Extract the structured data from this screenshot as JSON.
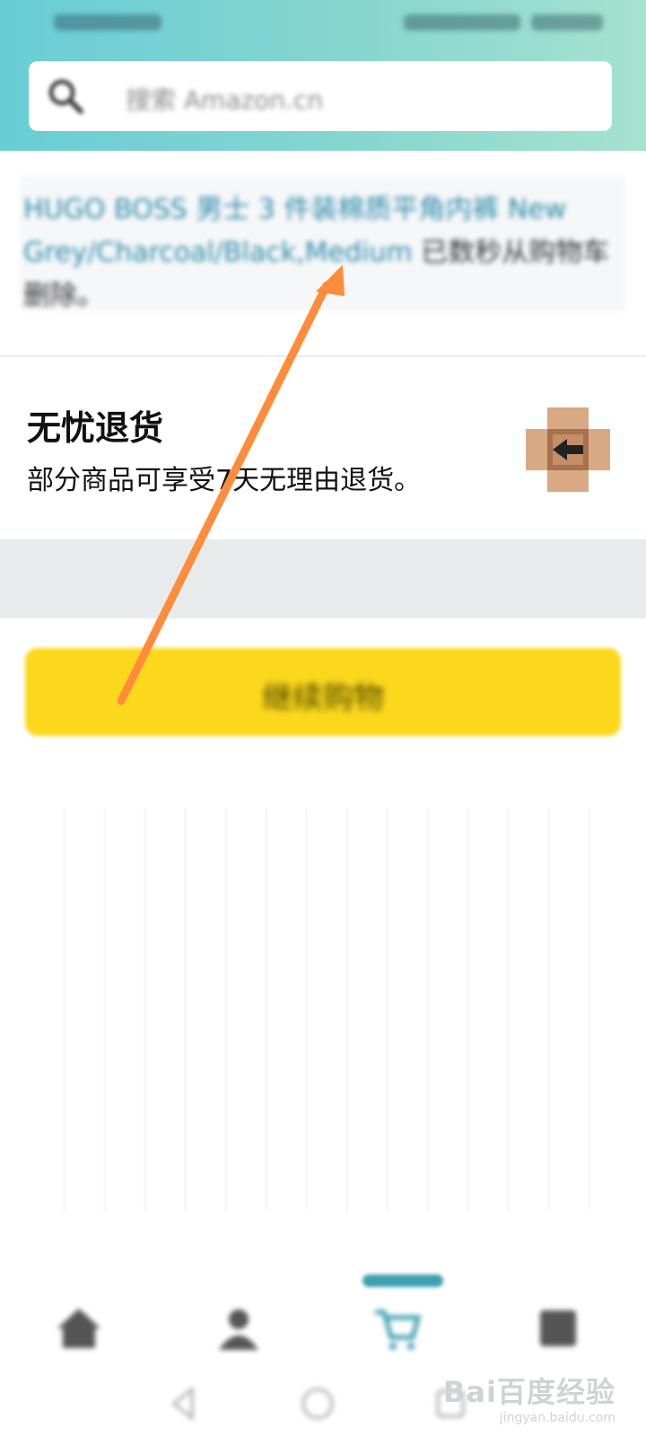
{
  "search": {
    "placeholder": "搜索 Amazon.cn"
  },
  "notice": {
    "product_link": "HUGO BOSS 男士 3 件装棉质平角内裤 New Grey/Charcoal/Black,Medium",
    "suffix": "已数秒从购物车删除。"
  },
  "returns": {
    "title": "无忧退货",
    "description": "部分商品可享受7天无理由退货。",
    "icon": "box-return-icon"
  },
  "continue_button": {
    "label": "继续购物"
  },
  "tabbar": {
    "active_index": 2,
    "items": [
      {
        "icon": "home-icon"
      },
      {
        "icon": "account-icon"
      },
      {
        "icon": "cart-icon"
      },
      {
        "icon": "menu-icon"
      }
    ]
  },
  "navbar": {
    "items": [
      {
        "icon": "back-icon"
      },
      {
        "icon": "home-circle-icon"
      },
      {
        "icon": "recents-icon"
      }
    ]
  },
  "annotation": {
    "arrow_color": "#ff8c3a"
  },
  "watermark": {
    "logo": "Bai百度经验",
    "url": "jingyan.baidu.com"
  },
  "colors": {
    "header_start": "#69cdd6",
    "header_end": "#a6e2cf",
    "button_yellow": "#fcd81c",
    "accent_teal": "#3f9fb0"
  }
}
